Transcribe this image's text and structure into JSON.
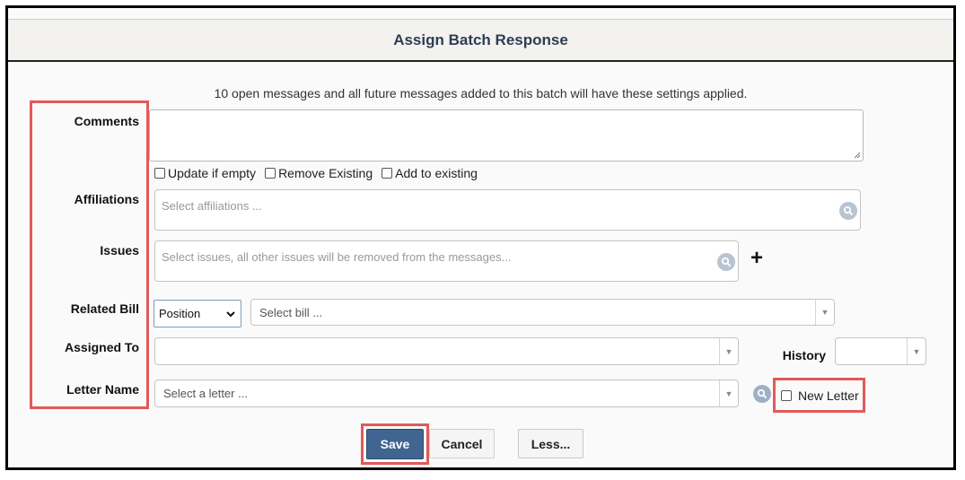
{
  "dialog": {
    "title": "Assign Batch Response",
    "info": "10 open messages and all future messages added to this batch will have these settings applied."
  },
  "labels": {
    "comments": "Comments",
    "affiliations": "Affiliations",
    "issues": "Issues",
    "related_bill": "Related Bill",
    "assigned_to": "Assigned To",
    "letter_name": "Letter Name",
    "history": "History"
  },
  "comments_options": {
    "update_if_empty": "Update if empty",
    "remove_existing": "Remove Existing",
    "add_to_existing": "Add to existing"
  },
  "fields": {
    "affiliations_placeholder": "Select affiliations ...",
    "issues_placeholder": "Select issues, all other issues will be removed from the messages...",
    "position_value": "Position",
    "bill_placeholder": "Select bill ...",
    "letter_placeholder": "Select a letter ...",
    "new_letter": "New Letter",
    "add_issue_symbol": "+"
  },
  "buttons": {
    "save": "Save",
    "cancel": "Cancel",
    "less": "Less..."
  },
  "colors": {
    "highlight": "#e05a5a",
    "save_bg": "#3f6590",
    "title_text": "#2e3d55"
  }
}
